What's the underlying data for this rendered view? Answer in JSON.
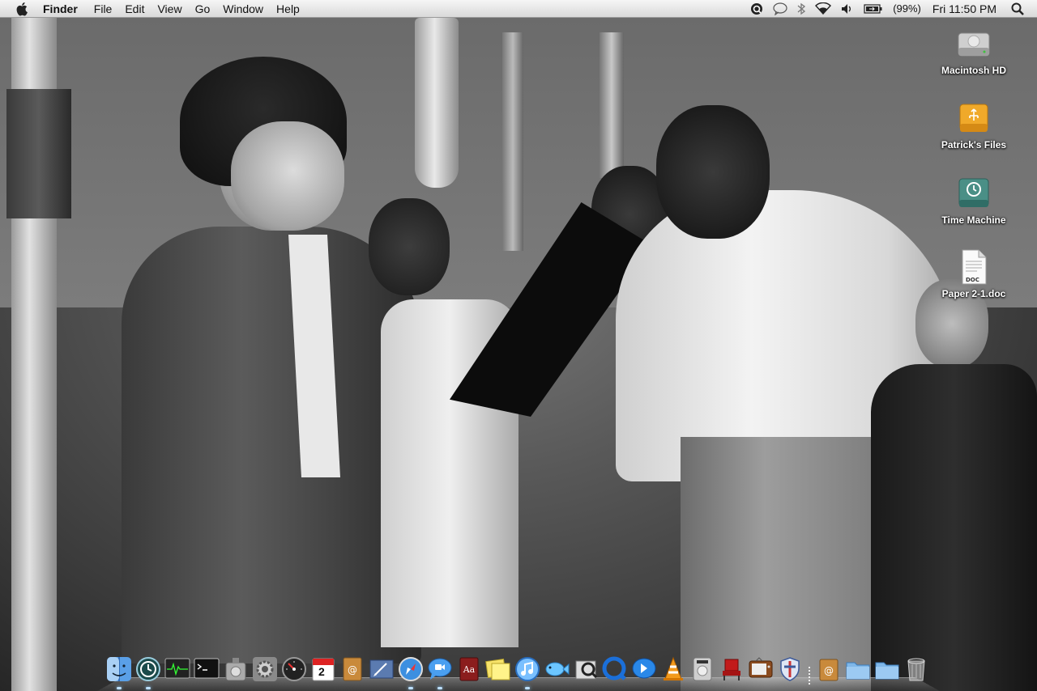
{
  "menubar": {
    "apple_icon": "apple-logo-icon",
    "app_name": "Finder",
    "menus": [
      "File",
      "Edit",
      "View",
      "Go",
      "Window",
      "Help"
    ],
    "status_icons": [
      "quicksilver-icon",
      "chat-bubble-icon",
      "bluetooth-icon",
      "wifi-icon",
      "volume-icon",
      "battery-icon"
    ],
    "battery_percent": "(99%)",
    "clock": "Fri 11:50 PM",
    "spotlight_icon": "spotlight-search-icon"
  },
  "desktop": {
    "icons": [
      {
        "name": "macintosh-hd",
        "label": "Macintosh HD",
        "icon": "hard-drive-icon"
      },
      {
        "name": "patricks-files",
        "label": "Patrick's Files",
        "icon": "usb-drive-icon"
      },
      {
        "name": "time-machine",
        "label": "Time Machine",
        "icon": "time-machine-drive-icon"
      },
      {
        "name": "paper-doc",
        "label": "Paper 2-1.doc",
        "icon": "doc-file-icon"
      }
    ],
    "doc_badge": "DOC"
  },
  "dock": {
    "items": [
      {
        "name": "finder",
        "icon": "finder-icon",
        "running": true
      },
      {
        "name": "time-machine",
        "icon": "time-machine-icon",
        "running": true
      },
      {
        "name": "activity-monitor",
        "icon": "activity-monitor-icon",
        "running": false
      },
      {
        "name": "terminal",
        "icon": "terminal-icon",
        "running": false
      },
      {
        "name": "disk-utility",
        "icon": "disk-utility-icon",
        "running": false
      },
      {
        "name": "system-preferences",
        "icon": "system-preferences-icon",
        "running": false
      },
      {
        "name": "dashboard",
        "icon": "dashboard-icon",
        "running": false
      },
      {
        "name": "ical",
        "icon": "calendar-icon",
        "running": false,
        "badge": "2"
      },
      {
        "name": "address-book",
        "icon": "address-book-icon",
        "running": false
      },
      {
        "name": "mail",
        "icon": "mail-icon",
        "running": false
      },
      {
        "name": "safari",
        "icon": "safari-icon",
        "running": true
      },
      {
        "name": "ichat",
        "icon": "ichat-icon",
        "running": true
      },
      {
        "name": "dictionary",
        "icon": "dictionary-icon",
        "running": false
      },
      {
        "name": "stickies",
        "icon": "stickies-icon",
        "running": false
      },
      {
        "name": "itunes",
        "icon": "itunes-icon",
        "running": true
      },
      {
        "name": "fish-app",
        "icon": "fish-icon",
        "running": false
      },
      {
        "name": "preview",
        "icon": "preview-icon",
        "running": false
      },
      {
        "name": "quicktime",
        "icon": "quicktime-icon",
        "running": false
      },
      {
        "name": "quicktime-alt",
        "icon": "quicktime-alt-icon",
        "running": false
      },
      {
        "name": "vlc",
        "icon": "vlc-cone-icon",
        "running": false
      },
      {
        "name": "dvd-player",
        "icon": "dvd-player-icon",
        "running": false
      },
      {
        "name": "front-row",
        "icon": "front-row-chair-icon",
        "running": false
      },
      {
        "name": "eyetv",
        "icon": "tv-icon",
        "running": false
      },
      {
        "name": "security-app",
        "icon": "shield-icon",
        "running": false
      }
    ],
    "stacks": [
      {
        "name": "documents-stack",
        "icon": "address-stack-icon"
      },
      {
        "name": "applications-stack",
        "icon": "folder-icon"
      },
      {
        "name": "downloads-stack",
        "icon": "folder-icon"
      },
      {
        "name": "trash",
        "icon": "trash-icon"
      }
    ],
    "calendar_badge": "2"
  },
  "colors": {
    "menubar_top": "#f6f6f6",
    "menubar_bottom": "#d9d9d9",
    "label_text": "#ffffff"
  }
}
